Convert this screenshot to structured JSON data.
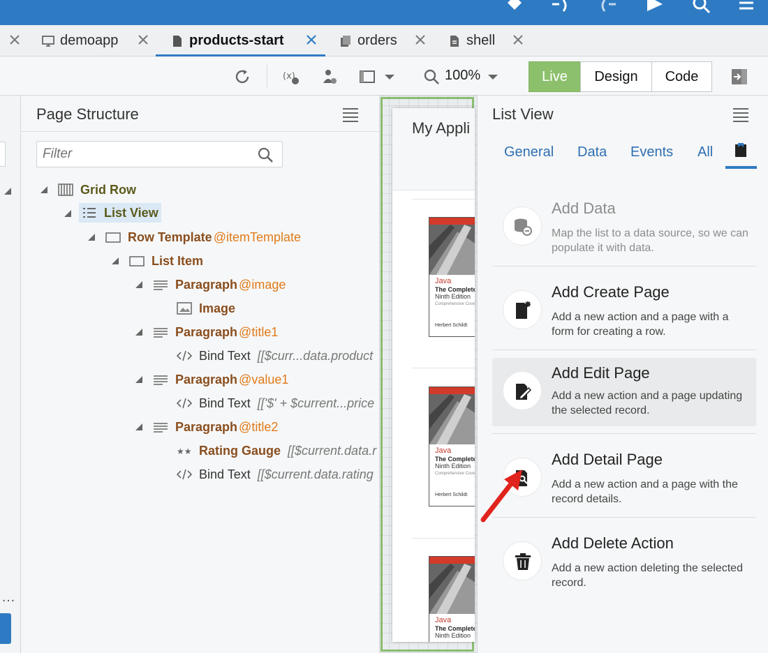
{
  "tabs": [
    {
      "label": "demoapp",
      "icon": "monitor-icon"
    },
    {
      "label": "products-start",
      "icon": "page-icon",
      "active": true
    },
    {
      "label": "orders",
      "icon": "pages-icon"
    },
    {
      "label": "shell",
      "icon": "shell-page-icon"
    }
  ],
  "toolbar": {
    "zoom": "100%",
    "modes": [
      "Live",
      "Design",
      "Code"
    ],
    "active_mode": "Live"
  },
  "page_structure": {
    "title": "Page Structure",
    "filter_placeholder": "Filter",
    "nodes": [
      {
        "label": "Grid Row",
        "icon": "grid-row-icon"
      },
      {
        "label": "List View",
        "icon": "list-view-icon",
        "selected": true
      },
      {
        "label": "Row Template",
        "attr": "@itemTemplate",
        "icon": "row-template-icon"
      },
      {
        "label": "List Item",
        "icon": "list-item-icon"
      },
      {
        "label": "Paragraph",
        "attr": "@image",
        "icon": "paragraph-icon"
      },
      {
        "label": "Image",
        "icon": "image-icon"
      },
      {
        "label": "Paragraph",
        "attr": "@title1",
        "icon": "paragraph-icon"
      },
      {
        "label": "Bind Text",
        "expr": "[[$curr...data.product",
        "icon": "code-icon"
      },
      {
        "label": "Paragraph",
        "attr": "@value1",
        "icon": "paragraph-icon"
      },
      {
        "label": "Bind Text",
        "expr": "[['$' + $current...price",
        "icon": "code-icon"
      },
      {
        "label": "Paragraph",
        "attr": "@title2",
        "icon": "paragraph-icon"
      },
      {
        "label": "Rating Gauge",
        "expr": "[[$current.data.r",
        "icon": "stars-icon"
      },
      {
        "label": "Bind Text",
        "expr": "[[$current.data.rating",
        "icon": "code-icon"
      }
    ]
  },
  "canvas": {
    "app_title": "My Appli",
    "book": {
      "line1": "Java",
      "line2": "The Complete",
      "line3": "Ninth Edition",
      "line4": "Comprehensive Coverage",
      "author": "Herbert Schildt"
    }
  },
  "list_view_panel": {
    "title": "List View",
    "tabs": [
      "General",
      "Data",
      "Events",
      "All"
    ],
    "actions": [
      {
        "title": "Add Data",
        "desc": "Map the list to a data source, so we can populate it with data.",
        "icon": "database-link-icon"
      },
      {
        "title": "Add Create Page",
        "desc": "Add a new action and a page with a form for creating a row.",
        "icon": "new-page-icon"
      },
      {
        "title": "Add Edit Page",
        "desc": "Add a new action and a page updating the selected record.",
        "icon": "edit-page-icon"
      },
      {
        "title": "Add Detail Page",
        "desc": "Add a new action and a page with the record details.",
        "icon": "detail-page-icon"
      },
      {
        "title": "Add Delete Action",
        "desc": "Add a new action deleting the selected record.",
        "icon": "trash-icon"
      }
    ]
  },
  "colors": {
    "topbar": "#2f7bc3",
    "live": "#8dc06d",
    "arrow": "#e0231c",
    "attr": "#e07a18"
  }
}
